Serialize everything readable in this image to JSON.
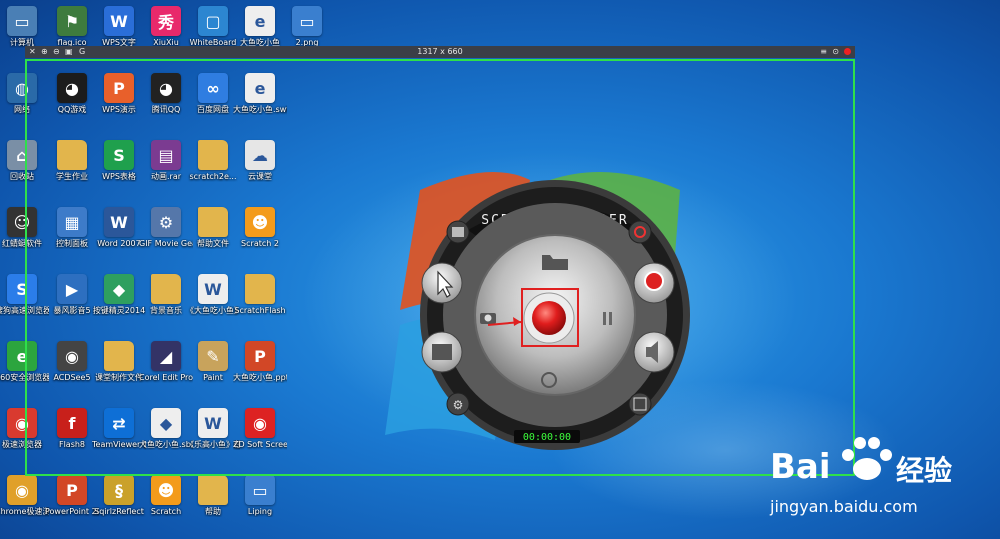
{
  "frame": {
    "size_label": "1317 x 660",
    "record_color": "#e22222",
    "border_color": "#2ee04a"
  },
  "recorder": {
    "title": "SCREEN RECORDER",
    "timer": "00:00:00",
    "accent": "#e02020"
  },
  "watermark": {
    "brand_left": "Bai",
    "brand_right": "经验",
    "url": "jingyan.baidu.com"
  },
  "icons": {
    "c1": [
      {
        "label": "计算机",
        "icon": "computer-icon",
        "color": "#4a7fb5",
        "glyph": "▭"
      },
      {
        "label": "网络",
        "icon": "network-icon",
        "color": "#2a6aa8",
        "glyph": "◍"
      },
      {
        "label": "回收站",
        "icon": "recycle-bin-icon",
        "color": "#7a8fa6",
        "glyph": "⌂"
      },
      {
        "label": "红蜻蜓软件",
        "icon": "person-icon",
        "color": "#333",
        "glyph": "☺"
      },
      {
        "label": "搜狗高速浏览器",
        "icon": "sogou-icon",
        "color": "#2b7de9",
        "glyph": "S"
      },
      {
        "label": "360安全浏览器",
        "icon": "360-icon",
        "color": "#2ca53e",
        "glyph": "e"
      },
      {
        "label": "极速浏览器",
        "icon": "chrome-icon",
        "color": "#d93a2f",
        "glyph": "◉"
      },
      {
        "label": "Chrome极速浏览器",
        "icon": "chrome-icon",
        "color": "#e0a02a",
        "glyph": "◉"
      }
    ],
    "c2": [
      {
        "label": "flag.ico",
        "icon": "flag-icon",
        "color": "#3e7b3e",
        "glyph": "⚑"
      },
      {
        "label": "QQ游戏",
        "icon": "qq-game-icon",
        "color": "#1c1c1c",
        "glyph": "◕"
      },
      {
        "label": "学生作业",
        "icon": "folder-icon",
        "color": "#e2b54c",
        "glyph": ""
      },
      {
        "label": "控制面板",
        "icon": "control-panel-icon",
        "color": "#3d7bc9",
        "glyph": "▦"
      },
      {
        "label": "暴风影音5",
        "icon": "baofeng-icon",
        "color": "#2d6fc0",
        "glyph": "▶"
      },
      {
        "label": "ACDSee5",
        "icon": "eye-icon",
        "color": "#444",
        "glyph": "◉"
      },
      {
        "label": "Flash8",
        "icon": "flash-icon",
        "color": "#c8201b",
        "glyph": "f"
      },
      {
        "label": "PowerPoint 2007",
        "icon": "powerpoint-icon",
        "color": "#d24726",
        "glyph": "P"
      }
    ],
    "c3": [
      {
        "label": "WPS文字",
        "icon": "wps-writer-icon",
        "color": "#2a6ed8",
        "glyph": "W"
      },
      {
        "label": "WPS演示",
        "icon": "wps-presentation-icon",
        "color": "#e8602b",
        "glyph": "P"
      },
      {
        "label": "WPS表格",
        "icon": "wps-spreadsheet-icon",
        "color": "#1fa04d",
        "glyph": "S"
      },
      {
        "label": "Word 2007",
        "icon": "word-icon",
        "color": "#2b579a",
        "glyph": "W"
      },
      {
        "label": "按键精灵2014",
        "icon": "keyboard-sprite-icon",
        "color": "#2e9f5f",
        "glyph": "◆"
      },
      {
        "label": "课堂制作文件",
        "icon": "folder-icon",
        "color": "#e2b54c",
        "glyph": ""
      },
      {
        "label": "TeamViewer 13",
        "icon": "teamviewer-icon",
        "color": "#0e6fd6",
        "glyph": "⇄"
      },
      {
        "label": "SqirlzReflect",
        "icon": "sqirlz-icon",
        "color": "#caa12a",
        "glyph": "§"
      }
    ],
    "c4": [
      {
        "label": "XiuXiu",
        "icon": "xiuxiu-icon",
        "color": "#e8296b",
        "glyph": "秀"
      },
      {
        "label": "腾讯QQ",
        "icon": "qq-icon",
        "color": "#222",
        "glyph": "◕"
      },
      {
        "label": "动画.rar",
        "icon": "rar-icon",
        "color": "#7b3b91",
        "glyph": "▤"
      },
      {
        "label": "GIF Movie Gear",
        "icon": "gif-movie-gear-icon",
        "color": "#5577aa",
        "glyph": "⚙"
      },
      {
        "label": "背景音乐",
        "icon": "folder-icon",
        "color": "#e2b54c",
        "glyph": ""
      },
      {
        "label": "Corel Edit Pro 3.0",
        "icon": "corel-icon",
        "color": "#333366",
        "glyph": "◢"
      },
      {
        "label": "大鱼吃小鱼.sb2",
        "icon": "scratch-file-icon",
        "color": "#eeeeee",
        "glyph": "◆"
      },
      {
        "label": "Scratch",
        "icon": "scratch-icon",
        "color": "#f39b1b",
        "glyph": "☻"
      }
    ],
    "c5": [
      {
        "label": "WhiteBoard",
        "icon": "whiteboard-icon",
        "color": "#2c86d1",
        "glyph": "▢"
      },
      {
        "label": "百度网盘",
        "icon": "baidu-netdisk-icon",
        "color": "#2f7de1",
        "glyph": "∞"
      },
      {
        "label": "scratch2e...",
        "icon": "folder-icon",
        "color": "#e2b54c",
        "glyph": ""
      },
      {
        "label": "帮助文件",
        "icon": "folder-icon",
        "color": "#e2b54c",
        "glyph": ""
      },
      {
        "label": "《大鱼吃小鱼》任务",
        "icon": "doc-icon",
        "color": "#eeeeee",
        "glyph": "W"
      },
      {
        "label": "Paint",
        "icon": "paint-icon",
        "color": "#c8a35c",
        "glyph": "✎"
      },
      {
        "label": "《乐高小鱼》任务单.docx",
        "icon": "doc-icon",
        "color": "#eeeeee",
        "glyph": "W"
      },
      {
        "label": "帮助",
        "icon": "folder-icon",
        "color": "#e2b54c",
        "glyph": ""
      }
    ],
    "c6": [
      {
        "label": "大鱼吃小鱼",
        "icon": "swf-file-icon",
        "color": "#eeeeee",
        "glyph": "e"
      },
      {
        "label": "大鱼吃小鱼.swf",
        "icon": "swf-file-icon",
        "color": "#eeeeee",
        "glyph": "e"
      },
      {
        "label": "云课堂",
        "icon": "cloud-class-icon",
        "color": "#e6e6e6",
        "glyph": "☁"
      },
      {
        "label": "Scratch 2",
        "icon": "scratch-cat-icon",
        "color": "#f39b1b",
        "glyph": "☻"
      },
      {
        "label": "ScratchFlash",
        "icon": "folder-icon",
        "color": "#e2b54c",
        "glyph": ""
      },
      {
        "label": "大鱼吃小鱼.pptx",
        "icon": "pptx-file-icon",
        "color": "#d24726",
        "glyph": "P"
      },
      {
        "label": "ZD Soft Screen ...",
        "icon": "screen-recorder-icon",
        "color": "#d22",
        "glyph": "◉"
      },
      {
        "label": "Liping",
        "icon": "image-icon",
        "color": "#3a7fcf",
        "glyph": "▭"
      }
    ],
    "c7": [
      {
        "label": "2.png",
        "icon": "image-icon",
        "color": "#3a7fcf",
        "glyph": "▭"
      }
    ]
  }
}
